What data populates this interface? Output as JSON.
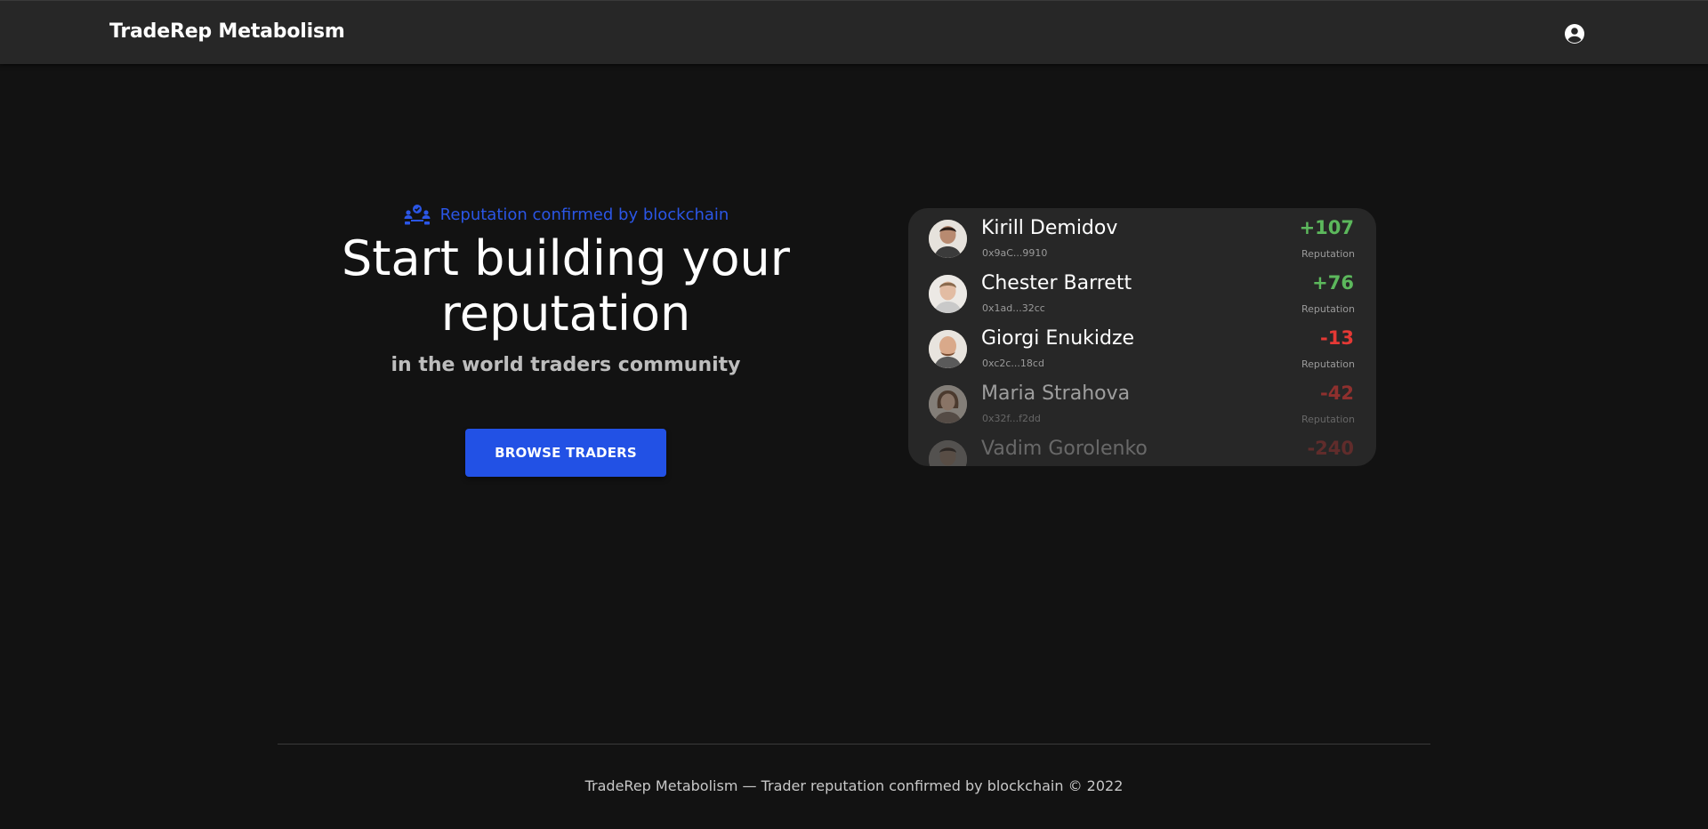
{
  "header": {
    "brand": "TradeRep Metabolism",
    "account_icon": "account-circle-icon"
  },
  "hero": {
    "badge_icon": "blockchain-verified-icon",
    "badge_text": "Reputation confirmed by blockchain",
    "title": "Start building your reputation",
    "subtitle": "in the world traders community",
    "cta_label": "BROWSE TRADERS"
  },
  "traders": [
    {
      "name": "Kirill Demidov",
      "address": "0x9aC...9910",
      "score": "+107",
      "score_label": "Reputation",
      "trend": "positive"
    },
    {
      "name": "Chester Barrett",
      "address": "0x1ad...32cc",
      "score": "+76",
      "score_label": "Reputation",
      "trend": "positive"
    },
    {
      "name": "Giorgi Enukidze",
      "address": "0xc2c...18cd",
      "score": "-13",
      "score_label": "Reputation",
      "trend": "negative"
    },
    {
      "name": "Maria Strahova",
      "address": "0x32f...f2dd",
      "score": "-42",
      "score_label": "Reputation",
      "trend": "negative"
    },
    {
      "name": "Vadim Gorolenko",
      "address": "",
      "score": "-240",
      "score_label": "",
      "trend": "negative"
    }
  ],
  "colors": {
    "accent": "#2251e5",
    "positive": "#5cb85c",
    "negative": "#e53935"
  },
  "footer": {
    "text": "TradeRep Metabolism — Trader reputation confirmed by blockchain © 2022"
  }
}
